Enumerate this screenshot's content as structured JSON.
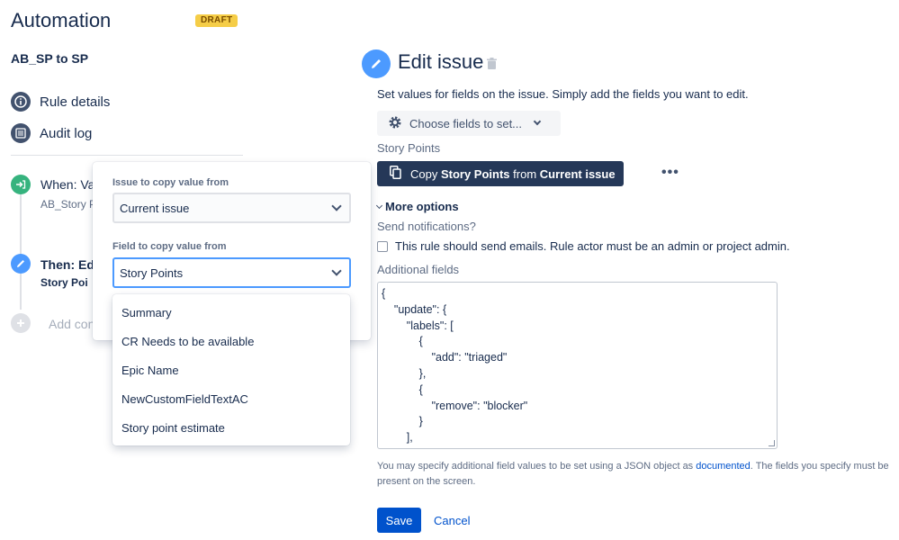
{
  "header": {
    "title": "Automation",
    "badge": "DRAFT"
  },
  "rule": {
    "name": "AB_SP to SP"
  },
  "nav": [
    {
      "label": "Rule details",
      "icon": "info-icon"
    },
    {
      "label": "Audit log",
      "icon": "list-icon"
    }
  ],
  "timeline": {
    "trigger_title": "When: Va",
    "trigger_subtitle": "AB_Story P",
    "action_title": "Then: Ed",
    "action_subtitle": "Story Poi",
    "add_label": "Add con"
  },
  "popup": {
    "issue_label": "Issue to copy value from",
    "issue_value": "Current issue",
    "field_label": "Field to copy value from",
    "field_value": "Story Points"
  },
  "dropdown": {
    "options": [
      "Summary",
      "CR Needs to be available",
      "Epic Name",
      "NewCustomFieldTextAC",
      "Story point estimate"
    ]
  },
  "edit": {
    "title": "Edit issue",
    "description": "Set values for fields on the issue. Simply add the fields you want to edit.",
    "choose_fields": "Choose fields to set...",
    "story_points_label": "Story Points",
    "copy_prefix": "Copy ",
    "copy_field": "Story Points",
    "copy_mid": " from ",
    "copy_source": "Current issue",
    "more_dots": "•••",
    "more_options": "More options",
    "send_notifications": "Send notifications?",
    "checkbox_label": "This rule should send emails. Rule actor must be an admin or project admin.",
    "additional_fields_label": "Additional fields",
    "json_lines": [
      "{",
      "    \"update\": {",
      "        \"labels\": [",
      "            {",
      "                \"add\": \"triaged\"",
      "            },",
      "            {",
      "                \"remove\": \"blocker\"",
      "            }",
      "        ],"
    ],
    "help_before": "You may specify additional field values to be set using a JSON object as ",
    "help_link": "documented",
    "help_after": ". The fields you specify must be present on the screen.",
    "save": "Save",
    "cancel": "Cancel"
  },
  "colors": {
    "primary": "#0052CC",
    "dark_button": "#253858",
    "draft": "#F5CD47",
    "trigger": "#36B37E",
    "action": "#4C9AFF"
  }
}
